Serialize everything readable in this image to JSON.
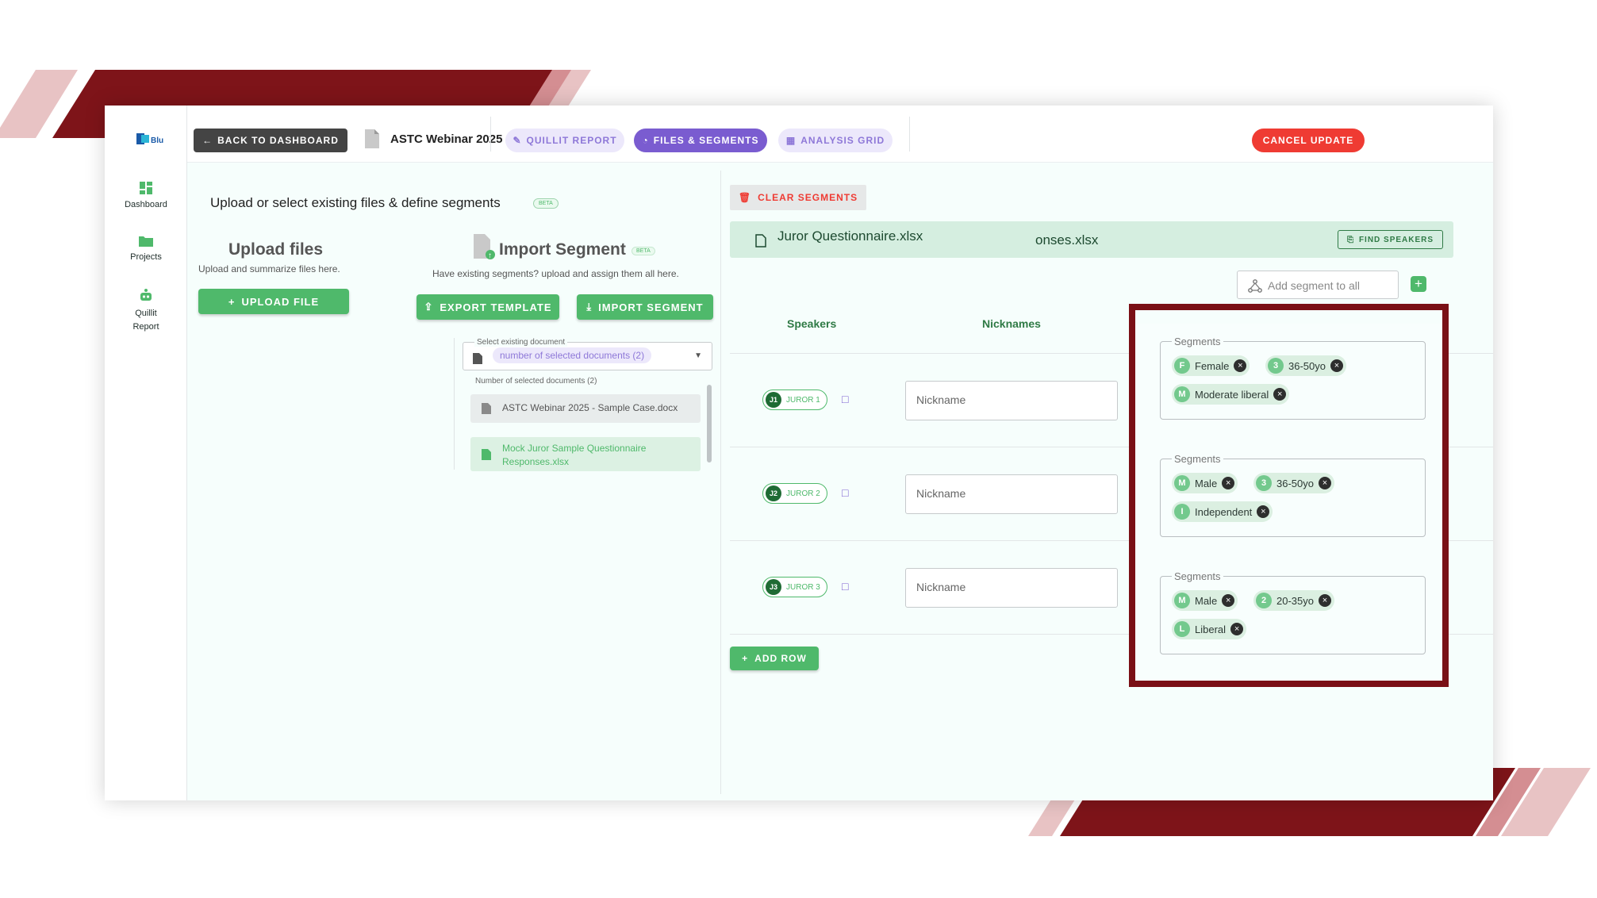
{
  "app": {
    "logo_text": "Blu"
  },
  "sidebar": {
    "items": [
      {
        "label": "Dashboard",
        "icon": "dashboard-icon"
      },
      {
        "label": "Projects",
        "icon": "folder-icon"
      },
      {
        "label": "Quillit Report",
        "icon": "robot-icon"
      }
    ]
  },
  "header": {
    "back_label": "BACK TO DASHBOARD",
    "project_title": "ASTC Webinar 2025",
    "tabs": [
      {
        "label": "QUILLIT REPORT",
        "active": false
      },
      {
        "label": "FILES & SEGMENTS",
        "active": true
      },
      {
        "label": "ANALYSIS GRID",
        "active": false
      }
    ],
    "cancel_label": "CANCEL UPDATE"
  },
  "left": {
    "heading": "Upload or select existing files & define segments",
    "beta": "BETA",
    "upload": {
      "title": "Upload files",
      "subtitle": "Upload and summarize files here.",
      "button": "UPLOAD FILE"
    },
    "import": {
      "title": "Import Segment",
      "beta": "BETA",
      "subtitle": "Have existing segments? upload and assign them all here.",
      "export_button": "EXPORT TEMPLATE",
      "import_button": "IMPORT SEGMENT"
    },
    "select": {
      "label": "Select existing document",
      "chip": "number of selected documents (2)",
      "count_label": "Number of selected documents (2)",
      "documents": [
        "ASTC Webinar 2025 - Sample Case.docx",
        "Mock Juror Sample Questionnaire Responses.xlsx"
      ]
    }
  },
  "right": {
    "clear_label": "CLEAR SEGMENTS",
    "file_tab_primary": "Juror Questionnaire.xlsx",
    "file_tab_secondary": "onses.xlsx",
    "find_label": "FIND SPEAKERS",
    "add_segment_placeholder": "Add segment to all",
    "columns": {
      "speakers": "Speakers",
      "nicknames": "Nicknames"
    },
    "nickname_placeholder": "Nickname",
    "segments_label": "Segments",
    "rows": [
      {
        "id": "J1",
        "label": "JUROR 1",
        "segments": [
          {
            "initial": "F",
            "text": "Female"
          },
          {
            "initial": "3",
            "text": "36-50yo"
          },
          {
            "initial": "M",
            "text": "Moderate liberal"
          }
        ]
      },
      {
        "id": "J2",
        "label": "JUROR 2",
        "segments": [
          {
            "initial": "M",
            "text": "Male"
          },
          {
            "initial": "3",
            "text": "36-50yo"
          },
          {
            "initial": "I",
            "text": "Independent"
          }
        ]
      },
      {
        "id": "J3",
        "label": "JUROR 3",
        "segments": [
          {
            "initial": "M",
            "text": "Male"
          },
          {
            "initial": "2",
            "text": "20-35yo"
          },
          {
            "initial": "L",
            "text": "Liberal"
          }
        ]
      }
    ],
    "add_row_label": "ADD ROW"
  },
  "colors": {
    "brand_green": "#4fb96b",
    "purple": "#7a5cd0",
    "danger": "#ef3b33",
    "highlight": "#7a1016"
  }
}
